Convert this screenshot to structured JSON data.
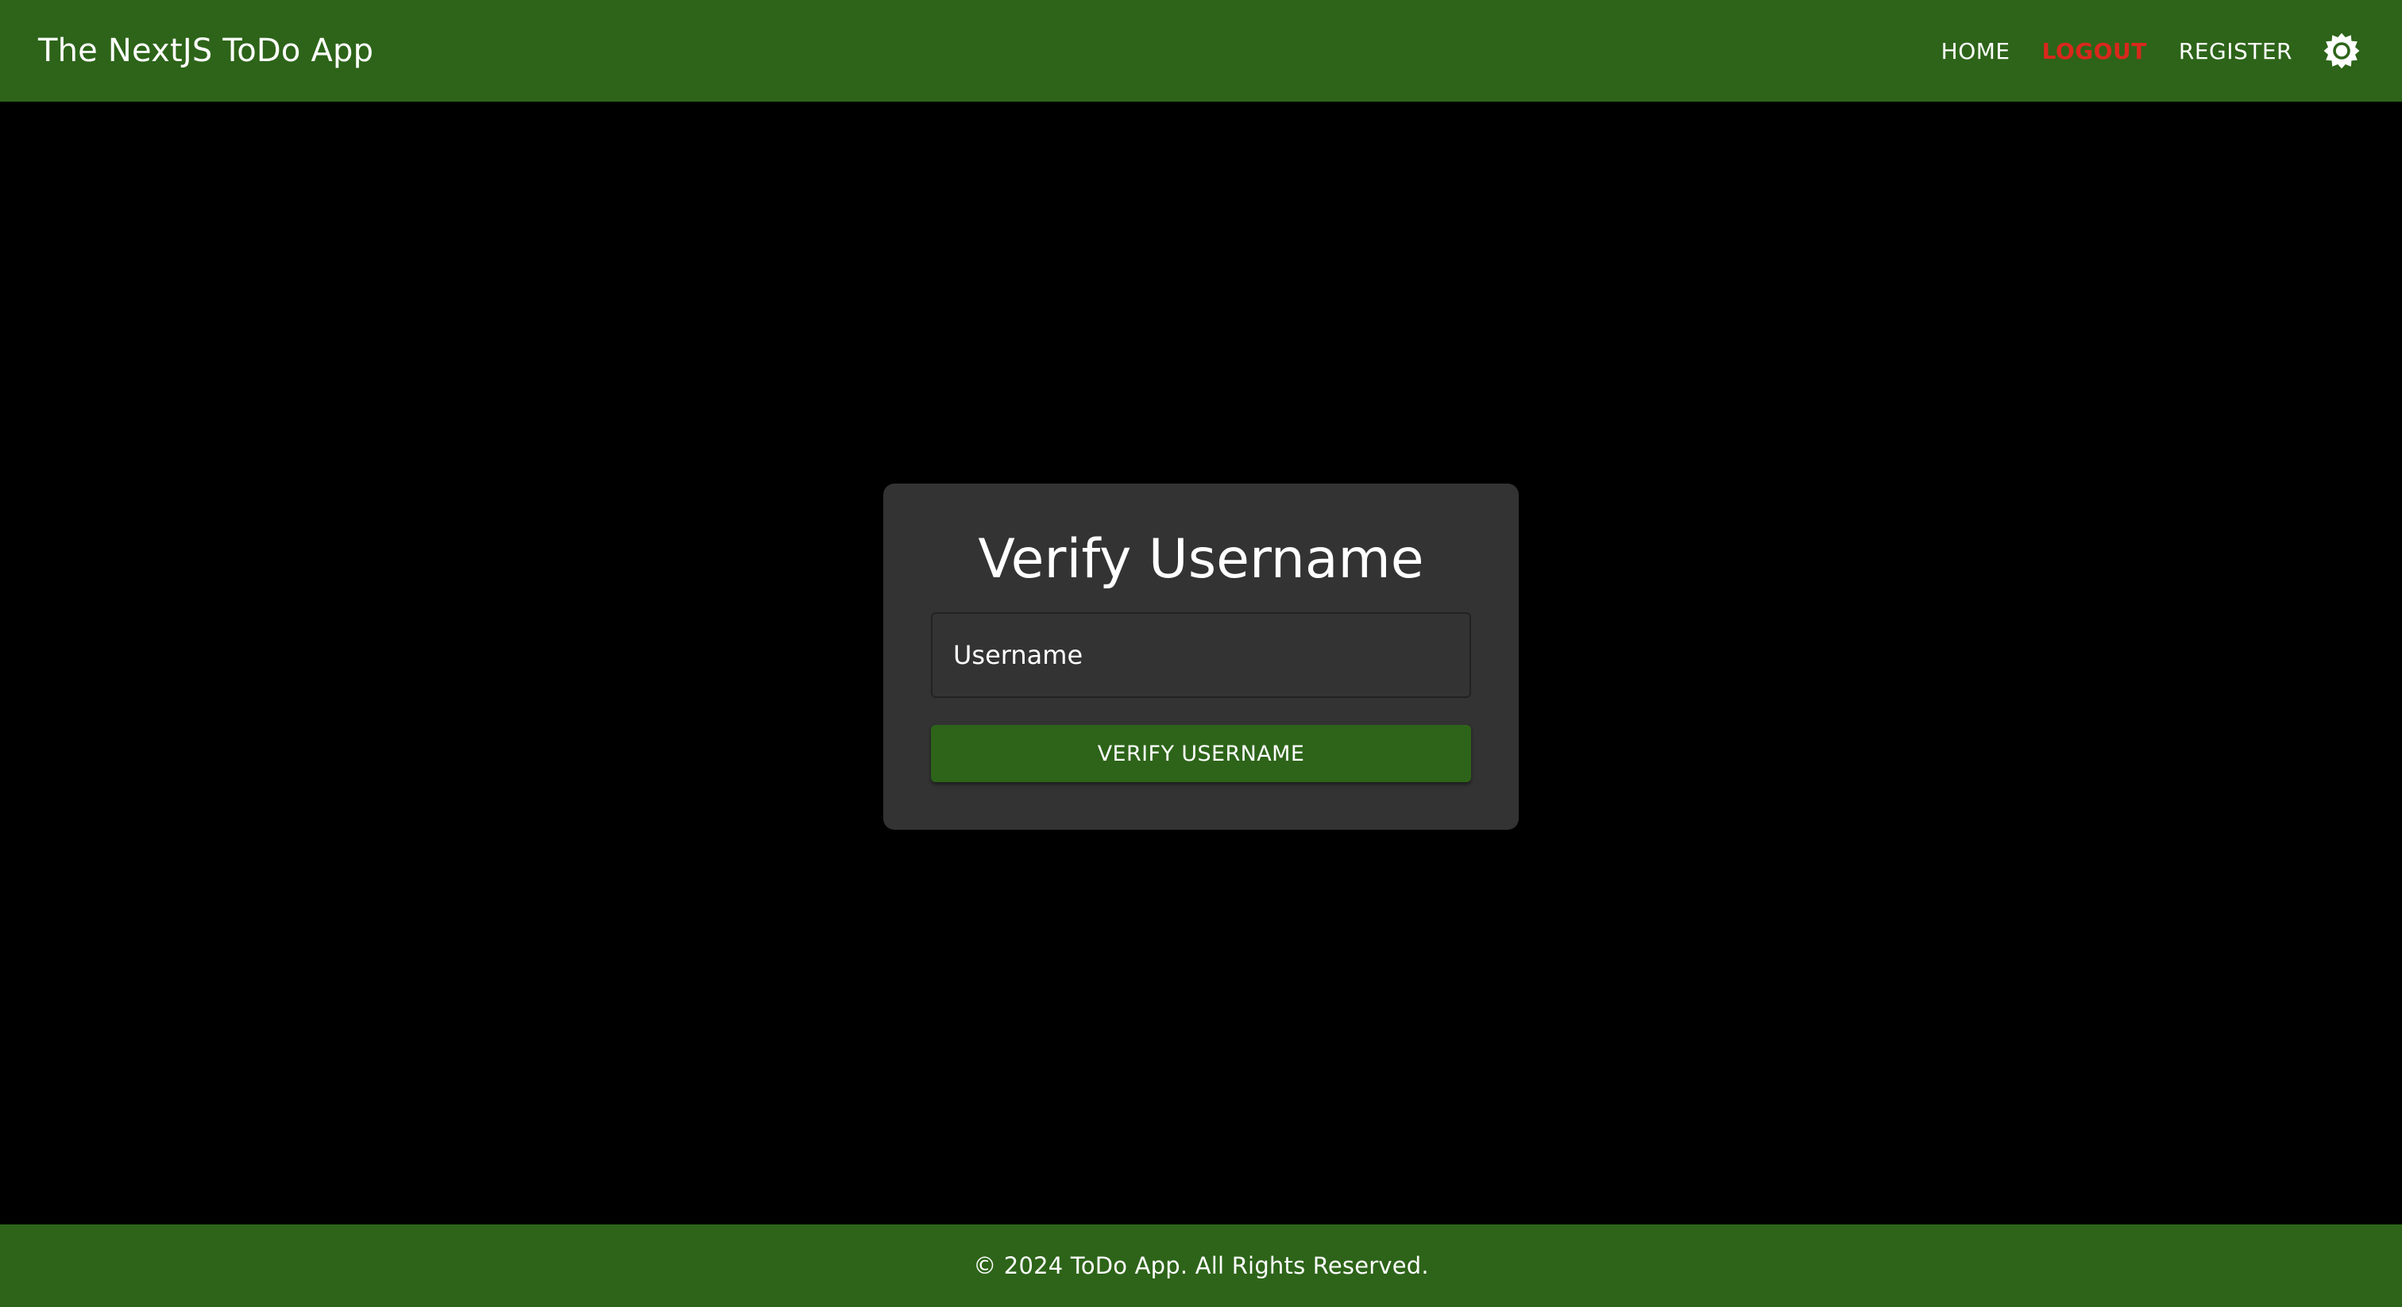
{
  "header": {
    "title": "The NextJS ToDo App",
    "nav": {
      "home": "HOME",
      "logout": "LOGOUT",
      "register": "REGISTER"
    },
    "theme_toggle_icon": "sun-icon"
  },
  "card": {
    "title": "Verify Username",
    "username_placeholder": "Username",
    "username_value": "",
    "submit_label": "VERIFY USERNAME"
  },
  "footer": {
    "text": "© 2024 ToDo App. All Rights Reserved."
  },
  "colors": {
    "brand_green": "#2d6419",
    "logout_red": "#d9281c",
    "card_background": "#333333",
    "page_background": "#000000"
  }
}
